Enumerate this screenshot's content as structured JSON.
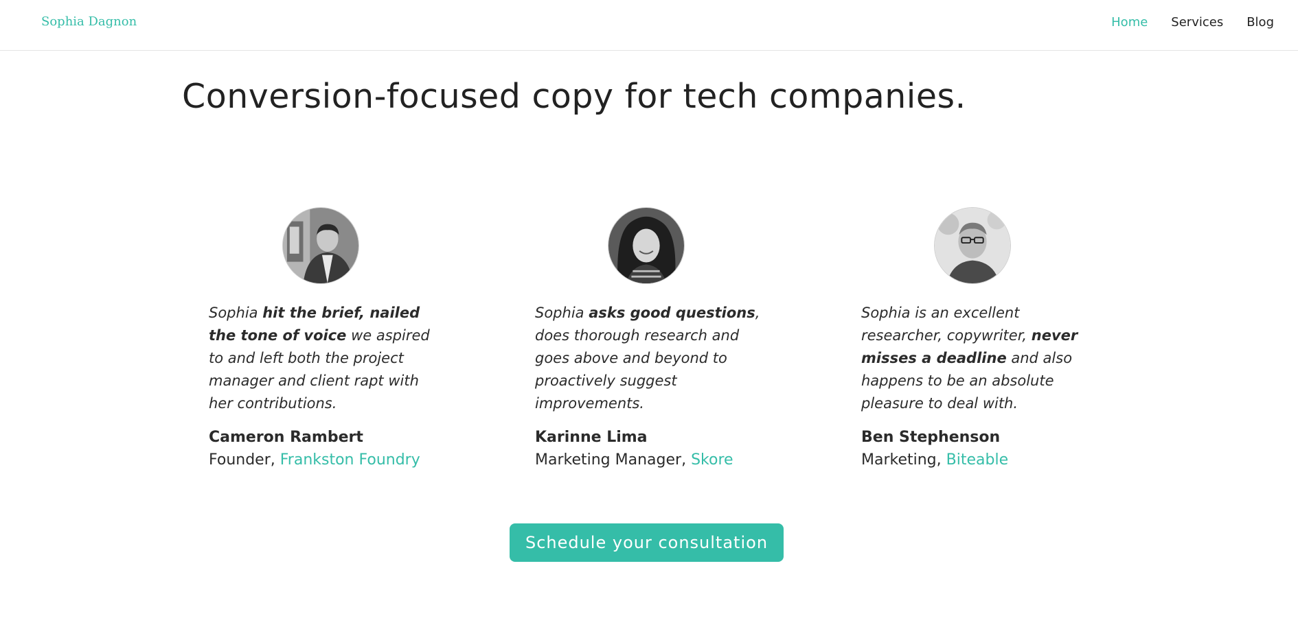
{
  "header": {
    "brand": "Sophia Dagnon",
    "nav": [
      {
        "label": "Home",
        "active": true
      },
      {
        "label": "Services",
        "active": false
      },
      {
        "label": "Blog",
        "active": false
      }
    ]
  },
  "hero": {
    "title": "Conversion-focused copy for tech companies."
  },
  "testimonials": [
    {
      "quote": [
        {
          "text": "Sophia ",
          "bold": false
        },
        {
          "text": "hit the brief, nailed the tone of voice",
          "bold": true
        },
        {
          "text": " we aspired to and left both the project manager and client rapt with her contributions.",
          "bold": false
        }
      ],
      "name": "Cameron Rambert",
      "role": "Founder, ",
      "company": "Frankston Foundry"
    },
    {
      "quote": [
        {
          "text": "Sophia ",
          "bold": false
        },
        {
          "text": "asks good questions",
          "bold": true
        },
        {
          "text": ", does thorough research and goes above and beyond to proactively suggest improvements.",
          "bold": false
        }
      ],
      "name": "Karinne Lima",
      "role": "Marketing Manager, ",
      "company": "Skore"
    },
    {
      "quote": [
        {
          "text": "Sophia is an excellent researcher, copywriter, ",
          "bold": false
        },
        {
          "text": "never misses a deadline",
          "bold": true
        },
        {
          "text": " and also happens to be an absolute pleasure to deal with.",
          "bold": false
        }
      ],
      "name": "Ben Stephenson",
      "role": "Marketing, ",
      "company": "Biteable"
    }
  ],
  "cta": {
    "label": "Schedule your consultation"
  },
  "colors": {
    "accent": "#35bda8",
    "text": "#2b2b2b"
  }
}
